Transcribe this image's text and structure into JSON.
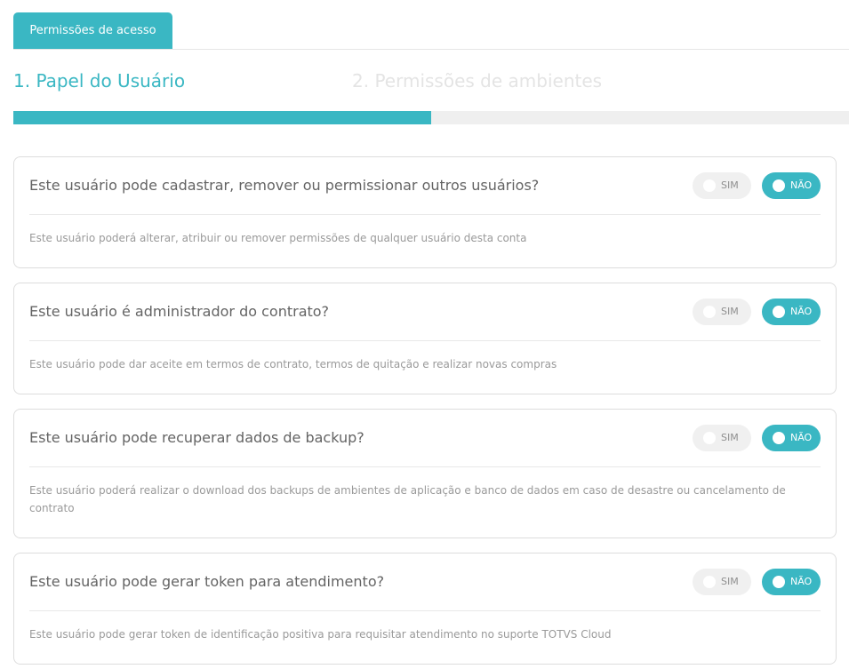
{
  "tab": {
    "label": "Permissões de acesso"
  },
  "steps": [
    {
      "label": "1. Papel do Usuário",
      "state": "active"
    },
    {
      "label": "2. Permissões de ambientes",
      "state": "inactive"
    }
  ],
  "progress": {
    "fraction": 0.5
  },
  "toggle_labels": {
    "yes": "SIM",
    "no": "NÃO"
  },
  "permissions": [
    {
      "question": "Este usuário pode cadastrar, remover ou permissionar outros usuários?",
      "description": "Este usuário poderá alterar, atribuir ou remover permissões de qualquer usuário desta conta",
      "selected": "no"
    },
    {
      "question": "Este usuário é administrador do contrato?",
      "description": "Este usuário pode dar aceite em termos de contrato, termos de quitação e realizar novas compras",
      "selected": "no"
    },
    {
      "question": "Este usuário pode recuperar dados de backup?",
      "description": "Este usuário poderá realizar o download dos backups de ambientes de aplicação e banco de dados em caso de desastre ou cancelamento de contrato",
      "selected": "no"
    },
    {
      "question": "Este usuário pode gerar token para atendimento?",
      "description": "Este usuário pode gerar token de identificação positiva para requisitar atendimento no suporte TOTVS Cloud",
      "selected": "no"
    }
  ],
  "colors": {
    "accent": "#3ab7c3",
    "inactive_step": "#e4e4e4",
    "toggle_off": "#f0f0f0"
  }
}
